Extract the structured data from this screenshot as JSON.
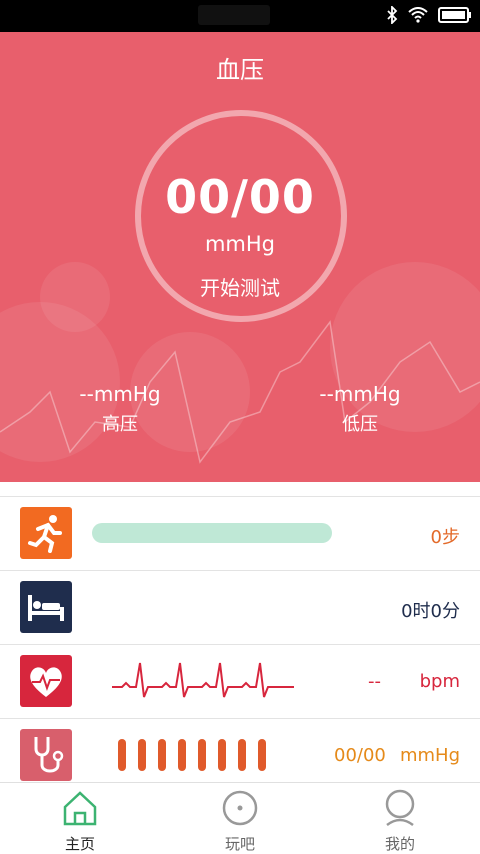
{
  "hero": {
    "title": "血压",
    "reading": "00/00",
    "unit": "mmHg",
    "start_label": "开始测试",
    "high": {
      "value": "--mmHg",
      "label": "高压"
    },
    "low": {
      "value": "--mmHg",
      "label": "低压"
    },
    "color": "#e85f6c"
  },
  "rows": {
    "steps": {
      "value": "0步",
      "progress": 0,
      "icon": "running-icon"
    },
    "sleep": {
      "value": "0时0分",
      "icon": "bed-icon"
    },
    "heart": {
      "value": "--",
      "unit": "bpm",
      "icon": "heart-ecg-icon"
    },
    "bp": {
      "value": "00/00",
      "unit": "mmHg",
      "icon": "stethoscope-icon"
    }
  },
  "tabs": [
    {
      "label": "主页",
      "icon": "home-icon",
      "active": true
    },
    {
      "label": "玩吧",
      "icon": "circle-icon",
      "active": false
    },
    {
      "label": "我的",
      "icon": "user-icon",
      "active": false
    }
  ],
  "colors": {
    "accent": "#3cb371",
    "orange": "#e36a2a",
    "navy": "#1f2d4d",
    "red": "#d7263d"
  }
}
